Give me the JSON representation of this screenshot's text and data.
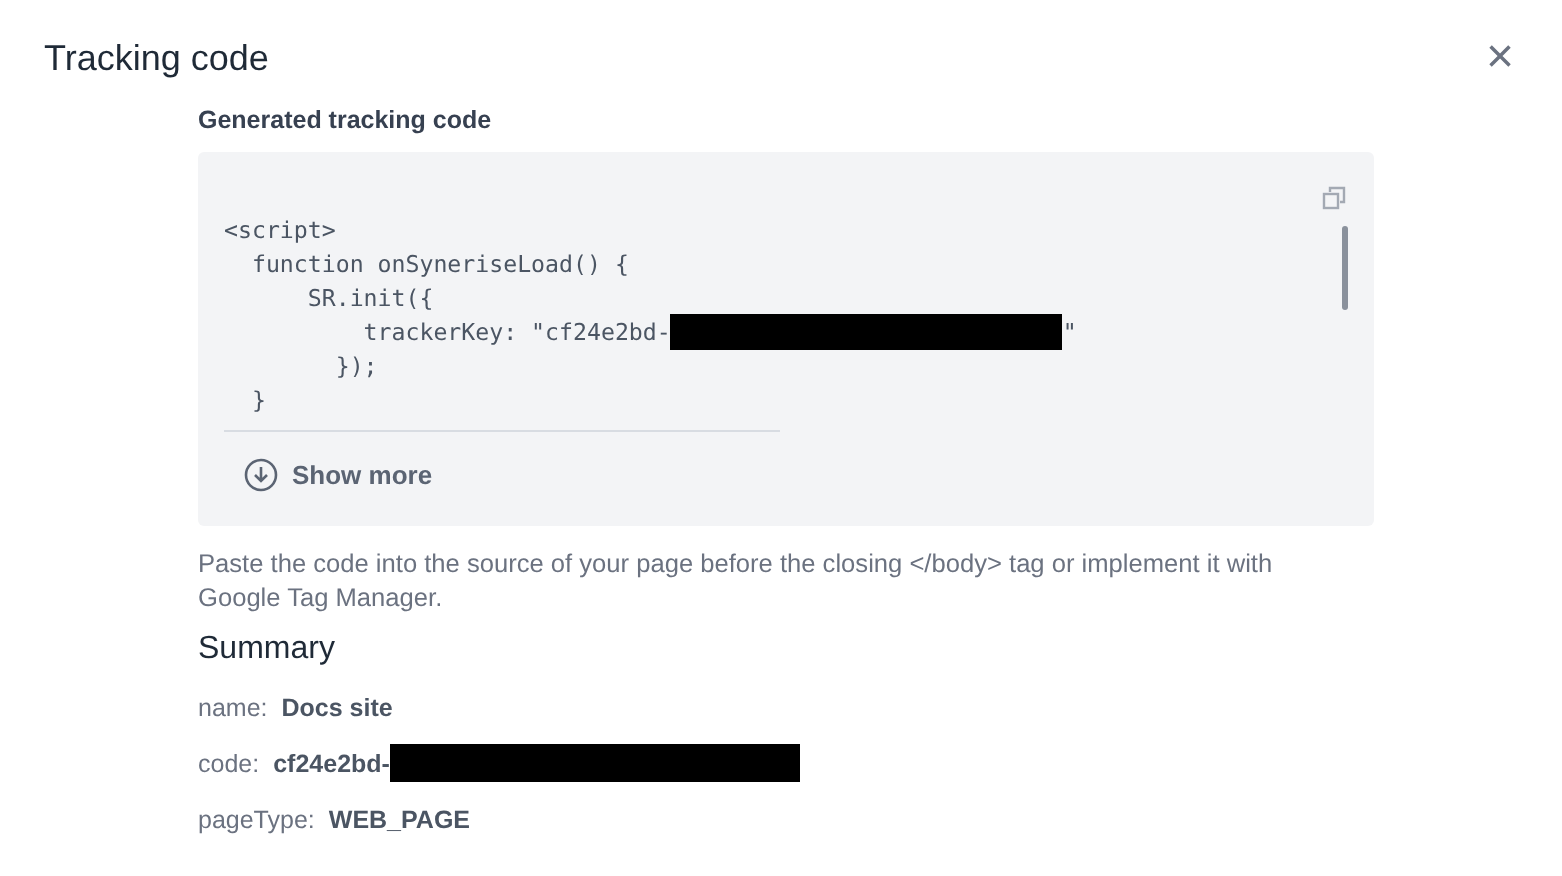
{
  "dialog": {
    "title": "Tracking code",
    "close_icon": "×"
  },
  "code_section": {
    "heading": "Generated tracking code",
    "lines": [
      {
        "text": "<script>",
        "redacted": false
      },
      {
        "text": "  function onSyneriseLoad() {",
        "redacted": false
      },
      {
        "text": "      SR.init({",
        "redacted": false
      },
      {
        "text": "          trackerKey: \"cf24e2bd-",
        "redacted": true,
        "after": "\""
      },
      {
        "text": "        });",
        "redacted": false
      },
      {
        "text": "  }",
        "redacted": false
      }
    ],
    "show_more": "Show more"
  },
  "instructions": "Paste the code into the source of your page before the closing </body> tag or implement it with Google Tag Manager.",
  "summary": {
    "heading": "Summary",
    "items": [
      {
        "label": "name:",
        "value": "Docs site",
        "redacted": false
      },
      {
        "label": "code:",
        "value": "cf24e2bd-",
        "redacted": true
      },
      {
        "label": "pageType:",
        "value": "WEB_PAGE",
        "redacted": false
      }
    ]
  }
}
